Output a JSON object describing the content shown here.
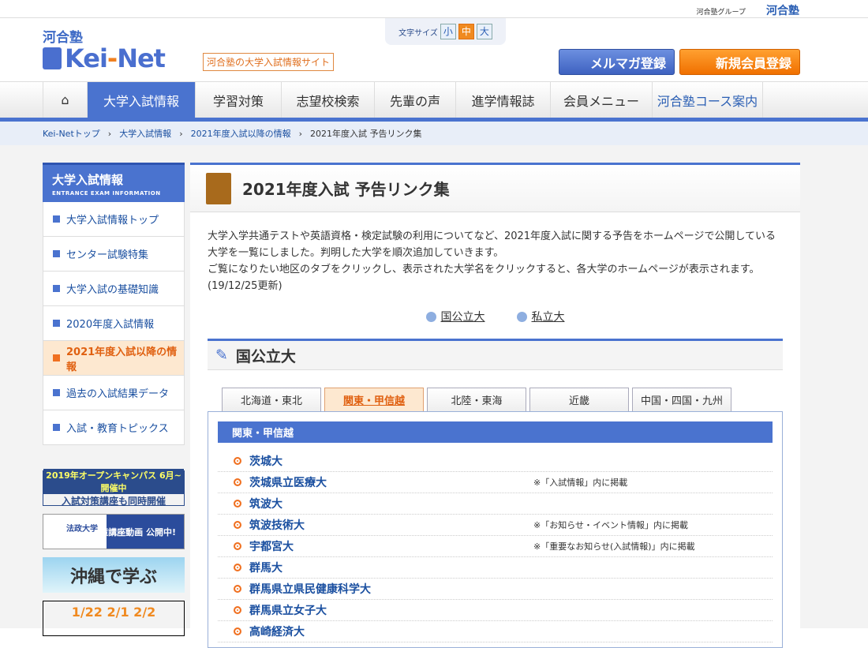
{
  "top": {
    "group": "河合塾グループ",
    "brand": "河合塾"
  },
  "header": {
    "logo_kawai": "河合塾",
    "logo_pre": "Kei",
    "logo_i": "-",
    "logo_post": "Net",
    "tagline": "河合塾の大学入試情報サイト",
    "font_size_label": "文字サイズ",
    "font_sizes": [
      "小",
      "中",
      "大"
    ],
    "mail_button": "メルマガ登録",
    "register_button": "新規会員登録"
  },
  "nav": [
    "大学入試情報",
    "学習対策",
    "志望校検索",
    "先輩の声",
    "進学情報誌",
    "会員メニュー",
    "河合塾コース案内"
  ],
  "breadcrumb": [
    "Kei-Netトップ",
    "大学入試情報",
    "2021年度入試以降の情報",
    "2021年度入試 予告リンク集"
  ],
  "sidebar": {
    "title": "大学入試情報",
    "subtitle": "ENTRANCE EXAM INFORMATION",
    "items": [
      "大学入試情報トップ",
      "センター試験特集",
      "大学入試の基礎知識",
      "2020年度入試情報",
      "2021年度入試以降の情報",
      "過去の入試結果データ",
      "入試・教育トピックス"
    ],
    "banners": {
      "b1a": "2019年オープンキャンパス 6月~開催中",
      "b1b": "入試対策講座も同時開催",
      "b2a": "法政大学",
      "b2b": "英語対策講座動画 公開中!",
      "b3": "沖縄で学ぶ",
      "b4": "1/22 2/1 2/2"
    }
  },
  "main": {
    "title": "2021年度入試 予告リンク集",
    "intro": [
      "大学入学共通テストや英語資格・検定試験の利用についてなど、2021年度入試に関する予告をホームページで公開している大学を一覧にしました。判明した大学を順次追加していきます。",
      "ご覧になりたい地区のタブをクリックし、表示された大学名をクリックすると、各大学のホームページが表示されます。",
      "(19/12/25更新)"
    ],
    "jump": [
      "国公立大",
      "私立大"
    ],
    "section": "国公立大",
    "tabs": [
      "北海道・東北",
      "関東・甲信越",
      "北陸・東海",
      "近畿",
      "中国・四国・九州"
    ],
    "panel_title": "関東・甲信越",
    "rows": [
      {
        "name": "茨城大",
        "note": ""
      },
      {
        "name": "茨城県立医療大",
        "note": "※「入試情報」内に掲載"
      },
      {
        "name": "筑波大",
        "note": ""
      },
      {
        "name": "筑波技術大",
        "note": "※「お知らせ・イベント情報」内に掲載"
      },
      {
        "name": "宇都宮大",
        "note": "※「重要なお知らせ(入試情報)」内に掲載"
      },
      {
        "name": "群馬大",
        "note": ""
      },
      {
        "name": "群馬県立県民健康科学大",
        "note": ""
      },
      {
        "name": "群馬県立女子大",
        "note": ""
      },
      {
        "name": "高崎経済大",
        "note": ""
      }
    ]
  }
}
